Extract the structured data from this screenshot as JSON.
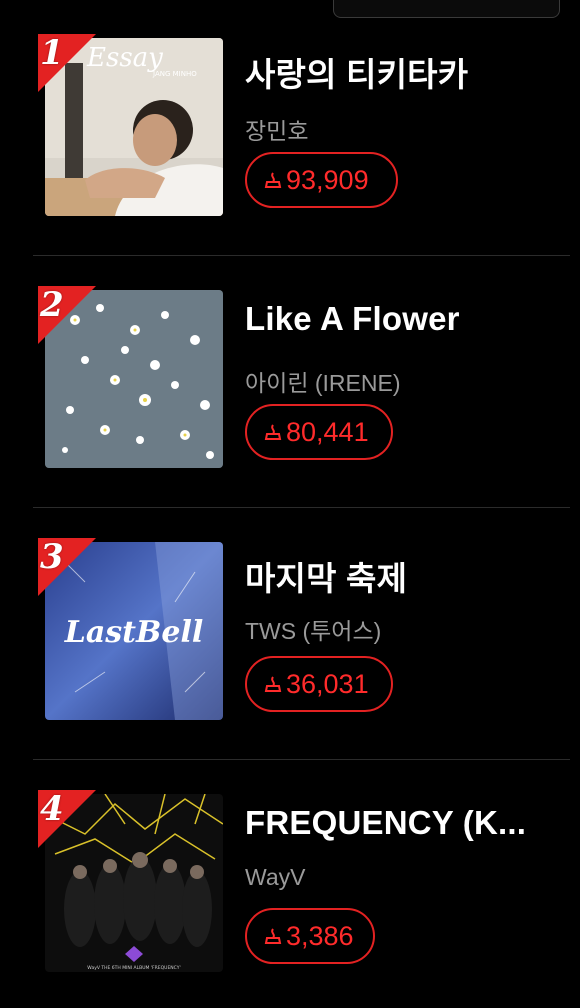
{
  "chart": {
    "items": [
      {
        "rank": "1",
        "title": "사랑의 티키타카",
        "artist": "장민호",
        "votes": "93,909",
        "cover_text": "Essay",
        "cover_sub": "JANG MINHO"
      },
      {
        "rank": "2",
        "title": "Like A Flower",
        "artist": "아이린 (IRENE)",
        "votes": "80,441"
      },
      {
        "rank": "3",
        "title": "마지막 축제",
        "artist": "TWS (투어스)",
        "votes": "36,031",
        "cover_text": "LastBell"
      },
      {
        "rank": "4",
        "title": "FREQUENCY (K...",
        "artist": "WayV",
        "votes": "3,386",
        "cover_sub": "WayV THE 6TH MINI ALBUM 'FREQUENCY'"
      }
    ]
  },
  "colors": {
    "accent": "#e32222",
    "vote_text": "#ff2b2b",
    "artist_text": "#9a9a9a",
    "background": "#000000"
  },
  "icons": {
    "vote": "vote-flame-icon",
    "rank": "rank-flag-icon"
  }
}
